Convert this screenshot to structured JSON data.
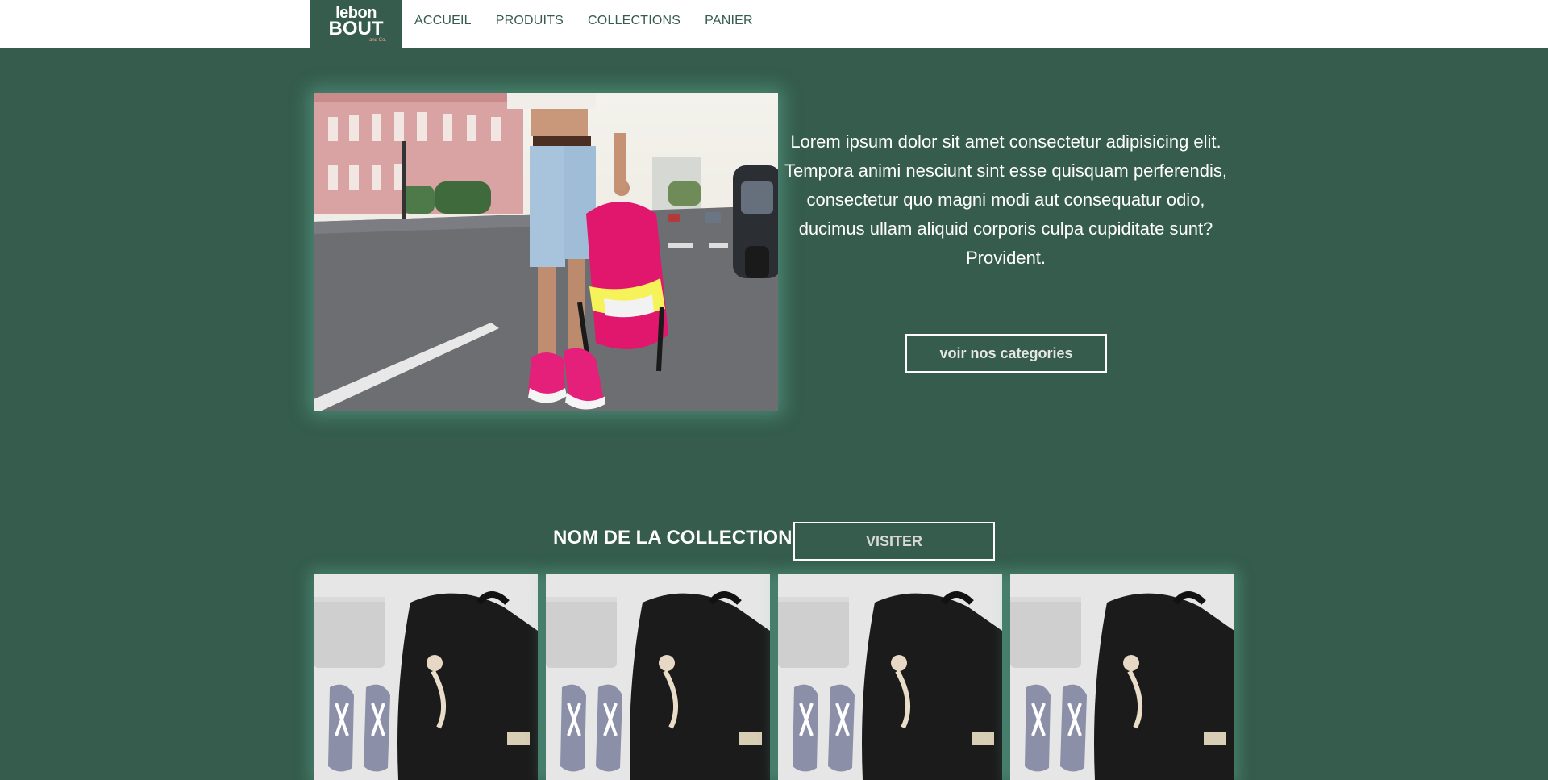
{
  "header": {
    "logo": {
      "line1": "lebon",
      "line2": "BOUT",
      "line3": "and Co."
    },
    "nav": [
      {
        "label": "ACCUEIL"
      },
      {
        "label": "PRODUITS"
      },
      {
        "label": "COLLECTIONS"
      },
      {
        "label": "PANIER"
      }
    ]
  },
  "hero": {
    "text": "Lorem ipsum dolor sit amet consectetur adipisicing elit. Tempora animi nesciunt sint esse quisquam perferendis, consectetur quo magni modi aut consequatur odio, ducimus ullam aliquid corporis culpa cupiditate sunt? Provident.",
    "button_label": "voir nos categories"
  },
  "collection": {
    "title": "NOM DE LA COLLECTION",
    "button_label": "VISITER",
    "cards": [
      {},
      {},
      {},
      {}
    ]
  },
  "colors": {
    "background": "#355c4d",
    "header": "#ffffff",
    "accent_text": "#355c4d",
    "backpack_pink": "#e0176d"
  }
}
